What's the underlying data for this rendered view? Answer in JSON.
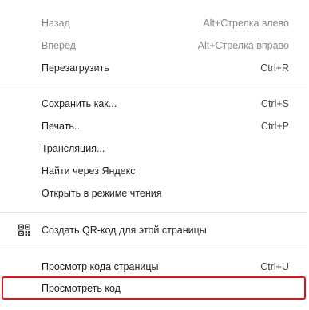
{
  "menu": {
    "items": [
      {
        "label": "Назад",
        "shortcut": "Alt+Стрелка влево"
      },
      {
        "label": "Вперед",
        "shortcut": "Alt+Стрелка вправо"
      },
      {
        "label": "Перезагрузить",
        "shortcut": "Ctrl+R"
      },
      {
        "label": "Сохранить как...",
        "shortcut": "Ctrl+S"
      },
      {
        "label": "Печать...",
        "shortcut": "Ctrl+P"
      },
      {
        "label": "Трансляция...",
        "shortcut": ""
      },
      {
        "label": "Найти через Яндекс",
        "shortcut": ""
      },
      {
        "label": "Открыть в режиме чтения",
        "shortcut": ""
      },
      {
        "label": "Создать QR-код для этой страницы",
        "shortcut": "",
        "icon": "qr-code-icon"
      },
      {
        "label": "Просмотр кода страницы",
        "shortcut": "Ctrl+U"
      },
      {
        "label": "Просмотреть код",
        "shortcut": ""
      }
    ]
  },
  "colors": {
    "highlight_border": "#e0121b",
    "disabled_text": "#8a8a8a",
    "text": "#1f1f1f"
  }
}
